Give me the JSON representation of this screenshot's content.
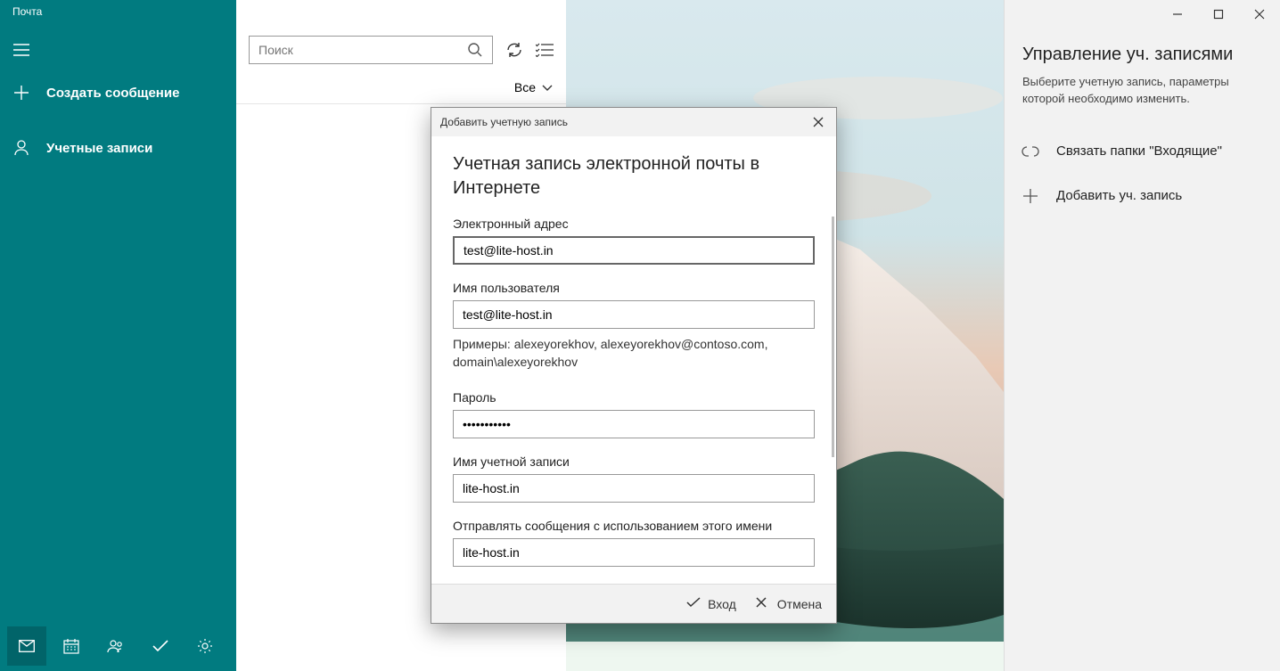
{
  "app_title": "Почта",
  "sidebar": {
    "compose": "Создать сообщение",
    "accounts": "Учетные записи"
  },
  "search": {
    "placeholder": "Поиск"
  },
  "filter": {
    "all": "Все"
  },
  "right": {
    "title": "Управление уч. записями",
    "desc": "Выберите учетную запись, параметры которой необходимо изменить.",
    "link_inboxes": "Связать папки \"Входящие\"",
    "add_account": "Добавить уч. запись"
  },
  "dialog": {
    "header": "Добавить учетную запись",
    "title": "Учетная запись электронной почты в Интернете",
    "email_label": "Электронный адрес",
    "email_value": "test@lite-host.in",
    "username_label": "Имя пользователя",
    "username_value": "test@lite-host.in",
    "username_hint": "Примеры: alexeyorekhov, alexeyorekhov@contoso.com, domain\\alexeyorekhov",
    "password_label": "Пароль",
    "password_value": "•••••••••••",
    "account_name_label": "Имя учетной записи",
    "account_name_value": "lite-host.in",
    "send_as_label": "Отправлять сообщения с использованием этого имени",
    "send_as_value": "lite-host.in",
    "signin": "Вход",
    "cancel": "Отмена"
  }
}
